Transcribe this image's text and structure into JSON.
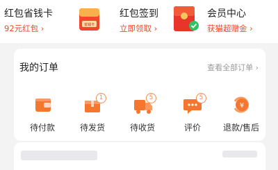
{
  "promo": {
    "items": [
      {
        "title": "红包省钱卡",
        "sub": "92元红包"
      },
      {
        "title": "红包签到",
        "sub": "立即领取"
      },
      {
        "title": "会员中心",
        "sub": "获猫超赠金"
      }
    ],
    "card_image_text": "省钱卡",
    "chevron": "›"
  },
  "orders": {
    "title": "我的订单",
    "view_all": "查看全部订单",
    "chevron": "›",
    "statuses": [
      {
        "label": "待付款",
        "icon": "wallet-icon"
      },
      {
        "label": "待发货",
        "icon": "package-icon",
        "badge": "1"
      },
      {
        "label": "待收货",
        "icon": "delivery-truck-icon",
        "badge": "5"
      },
      {
        "label": "评价",
        "icon": "chat-bubble-icon",
        "badge": "5"
      },
      {
        "label": "退款/售后",
        "icon": "refund-icon"
      }
    ]
  },
  "colors": {
    "accent": "#f0482a",
    "icon_orange": "#f5762f",
    "text": "#222222",
    "muted": "#9a9a9a"
  }
}
